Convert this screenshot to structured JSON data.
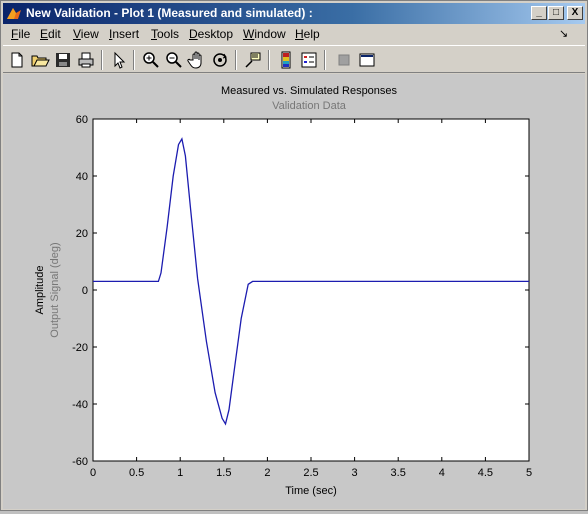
{
  "window": {
    "title": "New Validation - Plot 1 (Measured and simulated) :",
    "controls": {
      "minimize": "_",
      "maximize": "□",
      "close": "X"
    }
  },
  "menubar": {
    "items": [
      {
        "label": "File",
        "u": "F",
        "rest": "ile"
      },
      {
        "label": "Edit",
        "u": "E",
        "rest": "dit"
      },
      {
        "label": "View",
        "u": "V",
        "rest": "iew"
      },
      {
        "label": "Insert",
        "u": "I",
        "rest": "nsert"
      },
      {
        "label": "Tools",
        "u": "T",
        "rest": "ools"
      },
      {
        "label": "Desktop",
        "u": "D",
        "rest": "esktop"
      },
      {
        "label": "Window",
        "u": "W",
        "rest": "indow"
      },
      {
        "label": "Help",
        "u": "H",
        "rest": "elp"
      }
    ],
    "dock_arrow": "↘"
  },
  "toolbar": {
    "icons": [
      "new-file-icon",
      "open-folder-icon",
      "save-icon",
      "print-icon",
      "pointer-icon",
      "zoom-in-icon",
      "zoom-out-icon",
      "pan-hand-icon",
      "rotate-3d-icon",
      "data-cursor-icon",
      "colorbar-icon",
      "legend-icon",
      "hide-plot-tools-icon",
      "show-plot-tools-icon"
    ]
  },
  "chart_data": {
    "type": "line",
    "title": "Measured vs. Simulated Responses",
    "subtitle": "Validation Data",
    "xlabel": "Time (sec)",
    "ylabel": "Amplitude",
    "ylabel2": "Output Signal (deg)",
    "xlim": [
      0,
      5
    ],
    "ylim": [
      -60,
      60
    ],
    "xticks": [
      "0",
      "0.5",
      "1",
      "1.5",
      "2",
      "2.5",
      "3",
      "3.5",
      "4",
      "4.5",
      "5"
    ],
    "yticks": [
      "-60",
      "-40",
      "-20",
      "0",
      "20",
      "40",
      "60"
    ],
    "grid": false,
    "series": [
      {
        "color": "#1c1cb0",
        "x": [
          0,
          0.75,
          0.78,
          0.85,
          0.92,
          0.98,
          1.02,
          1.06,
          1.12,
          1.2,
          1.3,
          1.4,
          1.48,
          1.52,
          1.56,
          1.62,
          1.7,
          1.78,
          1.83,
          5
        ],
        "y": [
          3,
          3,
          6,
          22,
          40,
          51,
          53,
          47,
          28,
          4,
          -18,
          -36,
          -45,
          -47,
          -42,
          -28,
          -10,
          2,
          3,
          3
        ]
      }
    ]
  },
  "colors": {
    "plot_bg": "#ffffff",
    "figure_bg": "#c8c8c8",
    "title_text": "#000000",
    "subtitle_text": "#777777"
  }
}
